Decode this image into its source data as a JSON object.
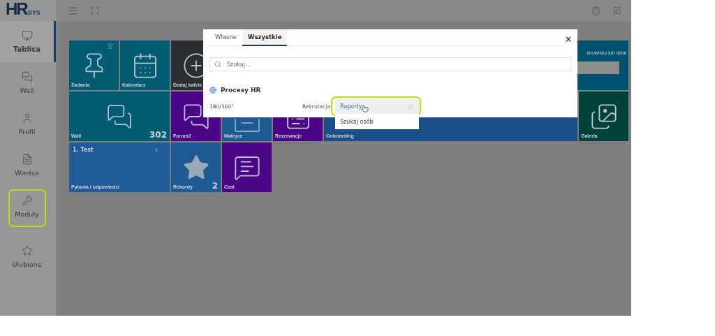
{
  "logo": {
    "mark": "HR",
    "suffix": "SYS"
  },
  "sidebar": {
    "items": [
      {
        "label": "Tablica",
        "selected": true,
        "annotated": false
      },
      {
        "label": "Wall",
        "selected": false,
        "annotated": false
      },
      {
        "label": "Profil",
        "selected": false,
        "annotated": false
      },
      {
        "label": "Wiedza",
        "selected": false,
        "annotated": false
      },
      {
        "label": "Moduły",
        "selected": false,
        "annotated": true
      }
    ],
    "bottom_items": [
      {
        "label": "Ulubione",
        "selected": false,
        "annotated": false
      }
    ]
  },
  "tiles": [
    {
      "kind": "icon",
      "label": "Zadania",
      "color": "#005b73"
    },
    {
      "kind": "icon",
      "label": "Kalendarz",
      "color": "#005b73"
    },
    {
      "kind": "icon",
      "label": "Dodaj kafele",
      "color": "#2b2e32"
    },
    {
      "kind": "search",
      "label": "anowisko lub dział",
      "color": "#005070"
    },
    {
      "kind": "icon",
      "label": "Wall",
      "color": "#005b73",
      "count": "302"
    },
    {
      "kind": "icon",
      "label": "Forum2",
      "color": "#4a0686"
    },
    {
      "kind": "icon",
      "label": "Matryce",
      "color": "#1d5a94"
    },
    {
      "kind": "icon",
      "label": "Rezerwacje",
      "color": "#4a0686"
    },
    {
      "kind": "plain",
      "label": "Onboarding",
      "color": "#1b4d88"
    },
    {
      "kind": "icon",
      "label": "Galeria",
      "color": "#03413d"
    },
    {
      "kind": "list",
      "label": "Pytania i odpowiedzi",
      "title": "1. Test",
      "color": "#1f5a99"
    },
    {
      "kind": "icon",
      "label": "Rekordy",
      "color": "#1d5a94",
      "count": "2"
    },
    {
      "kind": "icon",
      "label": "Czat",
      "color": "#4a0686"
    }
  ],
  "modal": {
    "tabs": [
      {
        "label": "Własne",
        "selected": false
      },
      {
        "label": "Wszystkie",
        "selected": true
      }
    ],
    "close": "×",
    "search": {
      "placeholder": "Szukaj..."
    },
    "section": "Procesy HR",
    "row": [
      "180/360°",
      "Rekrutacja"
    ],
    "dropdown": [
      {
        "label": "Raporty",
        "selected": true,
        "annotated": true
      },
      {
        "label": "Szukaj osób",
        "selected": false,
        "annotated": false
      }
    ]
  }
}
